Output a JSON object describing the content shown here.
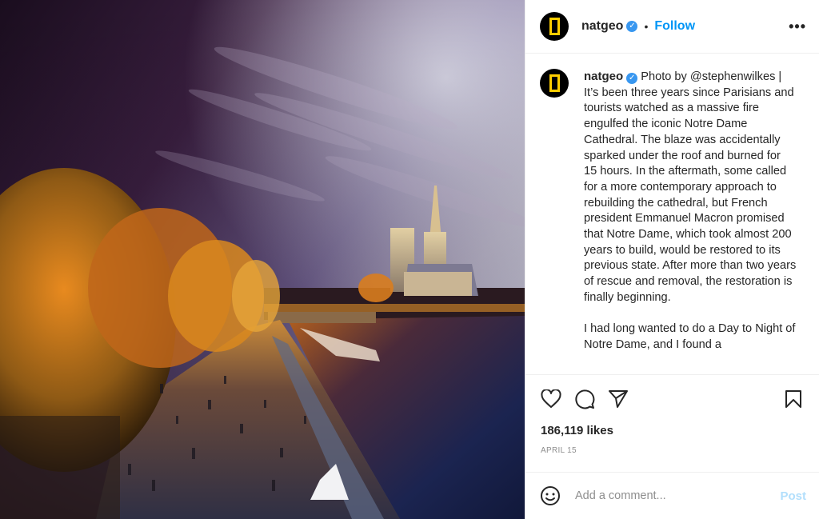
{
  "post": {
    "author": "natgeo",
    "verified": true,
    "follow_label": "Follow",
    "separator": "•",
    "more_label": "•••",
    "image_alt": "Day to Night photo of Notre Dame Cathedral and the Seine in Paris with autumn trees, crowds on the quay and a tour boat",
    "caption": {
      "author": "natgeo",
      "paragraphs": [
        "Photo by @stephenwilkes | It’s been three years since Parisians and tourists watched as a massive fire engulfed the iconic Notre Dame Cathedral. The blaze was accidentally sparked under the roof and burned for 15 hours. In the aftermath, some called for a more contemporary approach to rebuilding the cathedral, but French president Emmanuel Macron promised that Notre Dame, which took almost 200 years to build, would be restored to its previous state. After more than two years of rescue and removal, the restoration is finally beginning.",
        "I had long wanted to do a Day to Night of Notre Dame, and I found a"
      ]
    },
    "actions": {
      "like_icon": "heart-icon",
      "comment_icon": "comment-icon",
      "share_icon": "paper-plane-icon",
      "save_icon": "bookmark-icon"
    },
    "likes": "186,119 likes",
    "date": "April 15",
    "comment": {
      "emoji_icon": "smiley-icon",
      "placeholder": "Add a comment...",
      "value": "",
      "post_label": "Post"
    }
  },
  "colors": {
    "accent": "#0095f6",
    "verified": "#3897f0",
    "post_disabled": "#b2dffc",
    "logo_yellow": "#ffce00",
    "text": "#262626",
    "muted": "#8e8e8e"
  }
}
